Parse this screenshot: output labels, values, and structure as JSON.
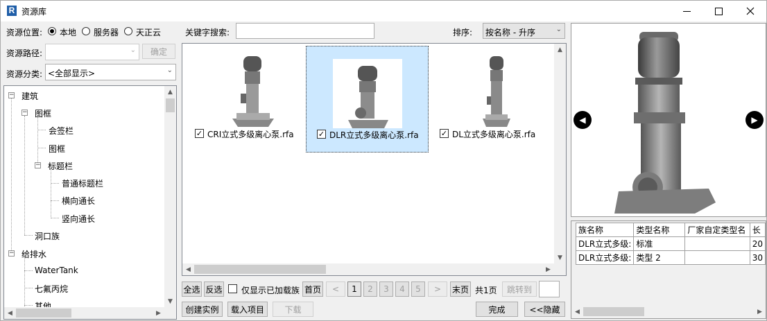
{
  "window": {
    "title": "资源库",
    "app_icon": "R"
  },
  "left": {
    "location_label": "资源位置:",
    "location_options": [
      "本地",
      "服务器",
      "天正云"
    ],
    "location_selected": "本地",
    "path_label": "资源路径:",
    "path_confirm": "确定",
    "category_label": "资源分类:",
    "category_value": "<全部显示>",
    "tree": {
      "n1": "建筑",
      "n2": "图框",
      "n3": "会签栏",
      "n4": "图框",
      "n5": "标题栏",
      "n6": "普通标题栏",
      "n7": "横向通长",
      "n8": "竖向通长",
      "n9": "洞口族",
      "n10": "给排水",
      "n11": "WaterTank",
      "n12": "七氟丙烷",
      "n13": "其他"
    }
  },
  "center": {
    "search_label": "关键字搜索:",
    "search_value": "",
    "sort_label": "排序:",
    "sort_value": "按名称 - 升序",
    "items": [
      {
        "name": "CRI立式多级离心泵.rfa",
        "checked": true
      },
      {
        "name": "DLR立式多级离心泵.rfa",
        "checked": true
      },
      {
        "name": "DL立式多级离心泵.rfa",
        "checked": true
      }
    ],
    "select_all": "全选",
    "invert": "反选",
    "only_loaded": "仅显示已加载族",
    "first_page": "首页",
    "prev": "<",
    "pages": [
      "1",
      "2",
      "3",
      "4",
      "5"
    ],
    "next": ">",
    "last_page": "末页",
    "total": "共1页",
    "jump": "跳转到",
    "create": "创建实例",
    "load": "载入项目",
    "download": "下载",
    "done": "完成",
    "hide": "<<隐藏"
  },
  "right": {
    "columns": [
      "族名称",
      "类型名称",
      "厂家自定类型名",
      "长"
    ],
    "rows": [
      [
        "DLR立式多级:",
        "标准",
        "",
        "20"
      ],
      [
        "DLR立式多级:",
        "类型 2",
        "",
        "30"
      ]
    ]
  },
  "colors": {
    "selection": "#cce8ff",
    "selection_border": "#99d1ff"
  }
}
